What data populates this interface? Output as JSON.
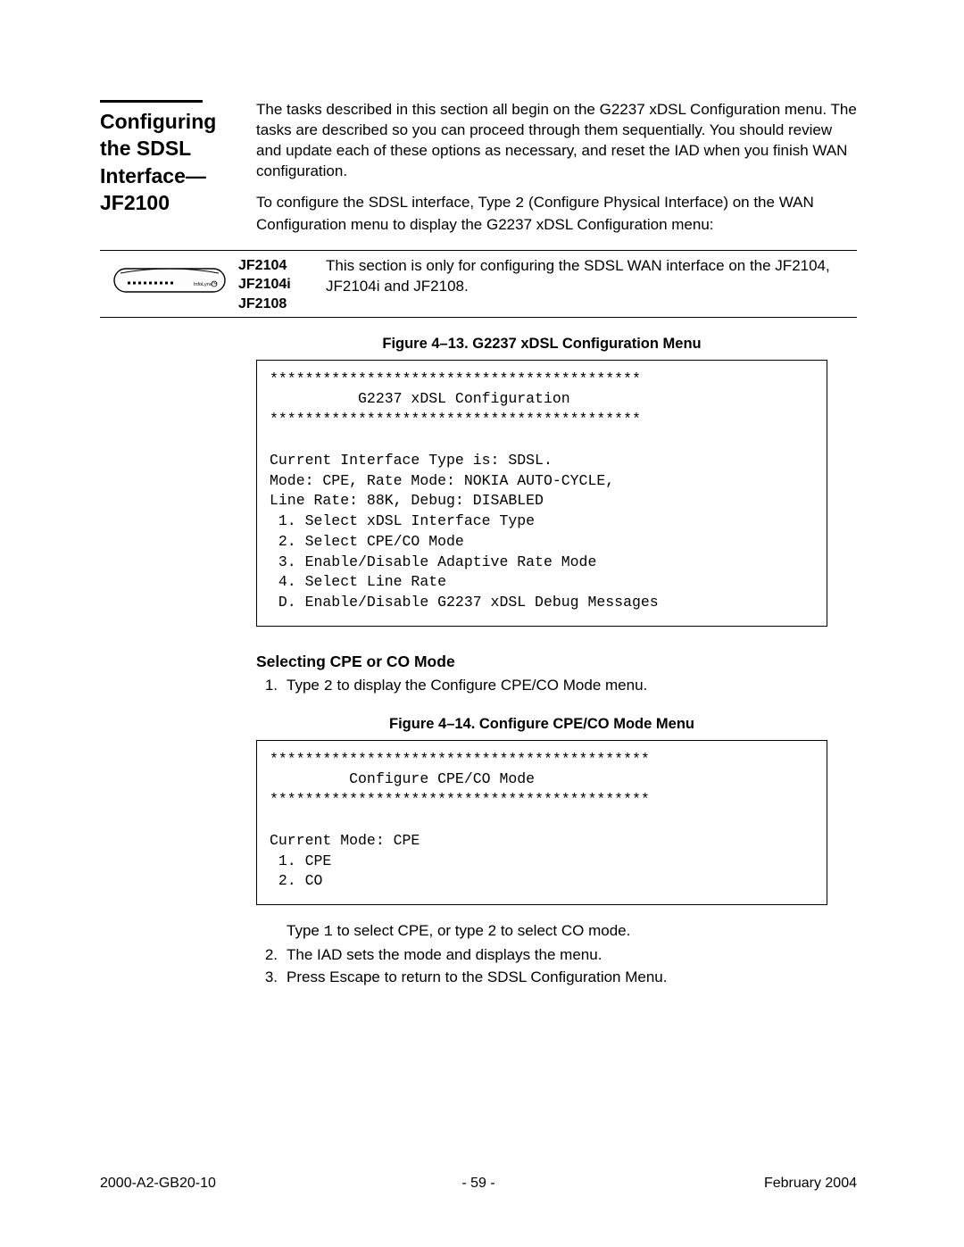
{
  "heading": "Configur­ing the SDSL Inter­face—JF2100",
  "intro_para": "The tasks described in this section all begin on the G2237 xDSL Configuration menu. The tasks are described so you can proceed through them sequentially. You should review and update each of these options as necessary, and reset the IAD when you finish WAN configuration.",
  "instruct_pre": "To configure the SDSL interface, Type ",
  "instruct_code": "2",
  "instruct_post": " (Configure Physical Interface) on the WAN Configuration menu to display the G2237 xDSL Configuration menu:",
  "device_labels": [
    "JF2104",
    "JF2104i",
    "JF2108"
  ],
  "device_desc": "This section is only for configuring the SDSL WAN interface on the JF2104, JF2104i and JF2108.",
  "fig1_caption": "Figure 4–13.  G2237 xDSL Configuration Menu",
  "terminal1": "******************************************\n          G2237 xDSL Configuration\n******************************************\n\nCurrent Interface Type is: SDSL.\nMode: CPE, Rate Mode: NOKIA AUTO-CYCLE,\nLine Rate: 88K, Debug: DISABLED\n 1. Select xDSL Interface Type\n 2. Select CPE/CO Mode\n 3. Enable/Disable Adaptive Rate Mode\n 4. Select Line Rate\n D. Enable/Disable G2237 xDSL Debug Messages",
  "sub1": "Selecting CPE or CO Mode",
  "step1_pre": "Type ",
  "step1_code": "2",
  "step1_post": " to display the Configure CPE/CO Mode menu.",
  "fig2_caption": "Figure 4–14.  Configure CPE/CO Mode Menu",
  "terminal2": "*******************************************\n         Configure CPE/CO Mode\n*******************************************\n\nCurrent Mode: CPE\n 1. CPE\n 2. CO",
  "note_pre": "Type ",
  "note_code": "1",
  "note_post": " to select CPE, or type 2 to select CO mode.",
  "step2": "The IAD sets the mode and displays the menu.",
  "step3": "Press Escape to return to the SDSL Configuration Menu.",
  "footer": {
    "left": "2000-A2-GB20-10",
    "center": "- 59 -",
    "right": "February 2004"
  }
}
